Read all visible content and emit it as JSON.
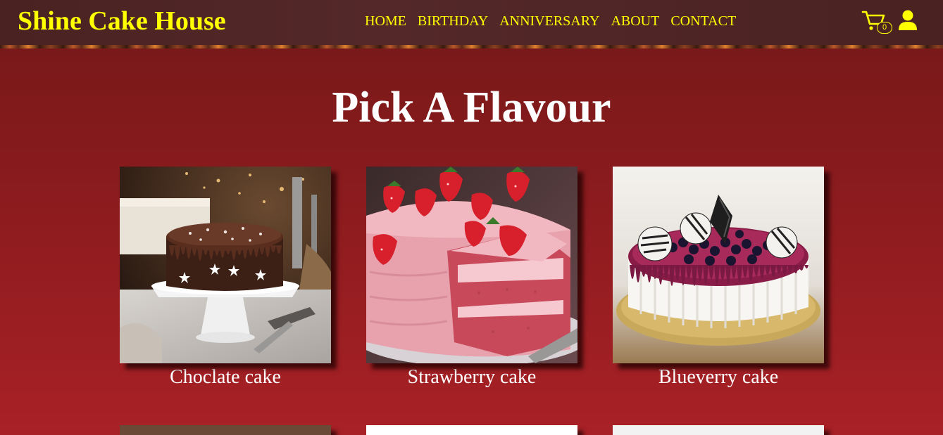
{
  "header": {
    "brand": "Shine Cake House",
    "nav": [
      {
        "label": "HOME"
      },
      {
        "label": "BIRTHDAY"
      },
      {
        "label": "ANNIVERSARY"
      },
      {
        "label": "ABOUT"
      },
      {
        "label": "CONTACT"
      }
    ],
    "cart_count": "0",
    "cart_icon": "cart-icon",
    "user_icon": "user-icon"
  },
  "main": {
    "title": "Pick A Flavour",
    "cards": [
      {
        "label": "Choclate cake"
      },
      {
        "label": "Strawberry cake"
      },
      {
        "label": "Blueverry cake"
      }
    ]
  },
  "colors": {
    "brand": "#ffff00",
    "background": "#8b1b1e",
    "navbar": "#4a2222",
    "text": "#ffffff"
  }
}
